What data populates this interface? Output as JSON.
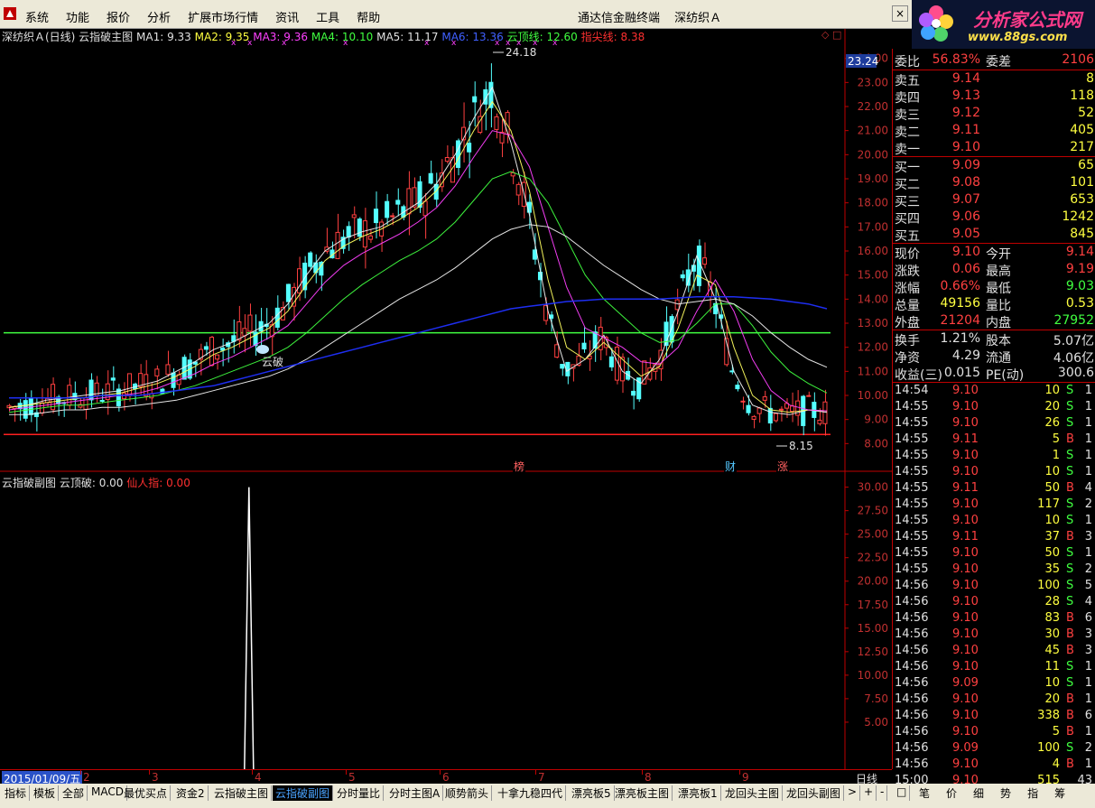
{
  "menubar": {
    "items": [
      "系统",
      "功能",
      "报价",
      "分析",
      "扩展市场行情",
      "资讯",
      "工具",
      "帮助"
    ],
    "center_title": [
      "通达信金融终端",
      "深纺织Ａ"
    ],
    "close": "×"
  },
  "logo": {
    "line1": "分析家公式网",
    "line2": "www.88gs.com"
  },
  "main_chart": {
    "title": "深纺织Ａ(日线) 云指破主图",
    "ma1": "MA1: 9.33",
    "ma2": "MA2: 9.35",
    "ma3": "MA3: 9.36",
    "ma4": "MA4: 10.10",
    "ma5": "MA5: 11.17",
    "ma6": "MA6: 13.36",
    "ydx": "云顶线: 12.60",
    "zjx": "指尖线: 8.38",
    "icons": "◇ □",
    "high_label": "24.18",
    "low_label": "8.15",
    "yun_label": "云破",
    "cur_price": "23.24",
    "markers": [
      "榜",
      "财",
      "涨"
    ]
  },
  "sub_chart": {
    "title": "云指破副图",
    "ydp": "云顶破: 0.00",
    "xrz": "仙人指: 0.00"
  },
  "chart_data": [
    {
      "type": "line",
      "title": "深纺织Ａ(日线) 云指破主图",
      "ylim": [
        7.6,
        24.4
      ],
      "y_ticks": [
        "24.00",
        "23.00",
        "22.00",
        "21.00",
        "20.00",
        "19.00",
        "18.00",
        "17.00",
        "16.00",
        "15.00",
        "14.00",
        "13.00",
        "12.00",
        "11.00",
        "10.00",
        "9.00",
        "8.00"
      ],
      "x_ticks": [
        "2",
        "3",
        "4",
        "5",
        "6",
        "7",
        "8",
        "9"
      ],
      "series": [
        {
          "name": "MA1",
          "values": [
            9.5,
            9.6,
            9.8,
            9.9,
            10.0,
            10.1,
            10.2,
            10.4,
            10.6,
            11.0,
            11.4,
            11.9,
            12.2,
            12.6,
            13.0,
            13.8,
            15.0,
            16.0,
            16.5,
            16.8,
            17.0,
            17.5,
            18.0,
            18.8,
            20.0,
            21.5,
            22.8,
            20.5,
            17.5,
            13.5,
            11.0,
            11.5,
            12.5,
            11.0,
            10.5,
            11.5,
            13.5,
            15.8,
            14.0,
            11.0,
            9.6,
            9.3,
            9.2,
            9.4,
            9.3
          ]
        },
        {
          "name": "MA2",
          "values": [
            9.5,
            9.6,
            9.7,
            9.8,
            9.9,
            10.0,
            10.1,
            10.3,
            10.5,
            10.8,
            11.2,
            11.7,
            12.0,
            12.4,
            12.8,
            13.5,
            14.6,
            15.6,
            16.2,
            16.6,
            16.9,
            17.3,
            17.8,
            18.5,
            19.6,
            21.0,
            22.2,
            21.0,
            18.5,
            14.8,
            12.0,
            11.5,
            12.2,
            11.5,
            10.8,
            11.2,
            12.8,
            15.0,
            14.6,
            12.0,
            10.0,
            9.4,
            9.3,
            9.4,
            9.35
          ]
        },
        {
          "name": "MA3",
          "values": [
            9.4,
            9.5,
            9.6,
            9.7,
            9.8,
            9.9,
            10.0,
            10.1,
            10.3,
            10.6,
            10.9,
            11.3,
            11.6,
            12.0,
            12.4,
            12.9,
            13.8,
            14.7,
            15.4,
            15.9,
            16.3,
            16.7,
            17.2,
            17.8,
            18.7,
            19.9,
            21.0,
            20.8,
            19.5,
            17.0,
            14.5,
            12.8,
            12.4,
            12.0,
            11.4,
            11.3,
            12.0,
            13.5,
            14.8,
            13.5,
            11.5,
            10.2,
            9.6,
            9.4,
            9.36
          ]
        },
        {
          "name": "MA4",
          "values": [
            9.3,
            9.4,
            9.5,
            9.6,
            9.6,
            9.7,
            9.8,
            9.9,
            10.0,
            10.2,
            10.4,
            10.7,
            11.0,
            11.3,
            11.6,
            12.0,
            12.6,
            13.3,
            14.0,
            14.6,
            15.1,
            15.6,
            16.0,
            16.5,
            17.2,
            18.1,
            19.0,
            19.3,
            19.0,
            18.0,
            16.5,
            15.0,
            14.0,
            13.3,
            12.6,
            12.2,
            12.3,
            13.0,
            13.8,
            13.8,
            12.9,
            11.8,
            11.0,
            10.5,
            10.1
          ]
        },
        {
          "name": "MA5",
          "values": [
            9.2,
            9.2,
            9.3,
            9.4,
            9.4,
            9.5,
            9.5,
            9.6,
            9.7,
            9.8,
            10.0,
            10.2,
            10.4,
            10.6,
            10.8,
            11.1,
            11.5,
            12.0,
            12.5,
            13.0,
            13.5,
            14.0,
            14.4,
            14.8,
            15.3,
            15.9,
            16.5,
            16.9,
            17.1,
            17.0,
            16.6,
            16.0,
            15.4,
            14.9,
            14.4,
            14.0,
            13.8,
            13.9,
            14.0,
            13.8,
            13.3,
            12.6,
            12.0,
            11.5,
            11.17
          ]
        },
        {
          "name": "MA6",
          "values": [
            9.9,
            9.9,
            9.9,
            9.9,
            9.9,
            10.0,
            10.0,
            10.0,
            10.1,
            10.2,
            10.3,
            10.4,
            10.6,
            10.8,
            11.0,
            11.2,
            11.4,
            11.6,
            11.8,
            12.0,
            12.2,
            12.4,
            12.6,
            12.8,
            13.0,
            13.2,
            13.4,
            13.6,
            13.7,
            13.8,
            13.9,
            13.95,
            14.0,
            14.0,
            14.0,
            14.0,
            14.05,
            14.1,
            14.1,
            14.1,
            14.05,
            14.0,
            13.9,
            13.8,
            13.6
          ]
        }
      ],
      "hlines": [
        {
          "name": "云顶线",
          "value": 12.6
        },
        {
          "name": "指尖线",
          "value": 8.38
        }
      ]
    },
    {
      "type": "line",
      "title": "云指破副图",
      "ylim": [
        0,
        31.5
      ],
      "y_ticks": [
        "30.00",
        "27.50",
        "25.00",
        "22.50",
        "20.00",
        "17.50",
        "15.00",
        "12.50",
        "10.00",
        "7.50",
        "5.00"
      ],
      "spike": {
        "x_frac": 0.3,
        "value": 30.0
      }
    }
  ],
  "panel": {
    "wb": {
      "label": "委比",
      "value": "56.83%",
      "label2": "委差",
      "value2": "2106"
    },
    "sell": [
      {
        "label": "卖五",
        "price": "9.14",
        "vol": "8"
      },
      {
        "label": "卖四",
        "price": "9.13",
        "vol": "118"
      },
      {
        "label": "卖三",
        "price": "9.12",
        "vol": "52"
      },
      {
        "label": "卖二",
        "price": "9.11",
        "vol": "405"
      },
      {
        "label": "卖一",
        "price": "9.10",
        "vol": "217"
      }
    ],
    "buy": [
      {
        "label": "买一",
        "price": "9.09",
        "vol": "65"
      },
      {
        "label": "买二",
        "price": "9.08",
        "vol": "101"
      },
      {
        "label": "买三",
        "price": "9.07",
        "vol": "653"
      },
      {
        "label": "买四",
        "price": "9.06",
        "vol": "1242"
      },
      {
        "label": "买五",
        "price": "9.05",
        "vol": "845"
      }
    ],
    "quote": [
      {
        "l1": "现价",
        "v1": "9.10",
        "c1": "c-red",
        "l2": "今开",
        "v2": "9.14",
        "c2": "c-red"
      },
      {
        "l1": "涨跌",
        "v1": "0.06",
        "c1": "c-red",
        "l2": "最高",
        "v2": "9.19",
        "c2": "c-red"
      },
      {
        "l1": "涨幅",
        "v1": "0.66%",
        "c1": "c-red",
        "l2": "最低",
        "v2": "9.03",
        "c2": "c-green"
      },
      {
        "l1": "总量",
        "v1": "49156",
        "c1": "c-yellow",
        "l2": "量比",
        "v2": "0.53",
        "c2": "c-yellow"
      },
      {
        "l1": "外盘",
        "v1": "21204",
        "c1": "c-red",
        "l2": "内盘",
        "v2": "27952",
        "c2": "c-green"
      }
    ],
    "fin": [
      {
        "l1": "换手",
        "v1": "1.21%",
        "l2": "股本",
        "v2": "5.07亿"
      },
      {
        "l1": "净资",
        "v1": "4.29",
        "l2": "流通",
        "v2": "4.06亿"
      },
      {
        "l1": "收益(三)",
        "v1": "0.015",
        "l2": "PE(动)",
        "v2": "300.6"
      }
    ],
    "ticks": [
      {
        "t": "14:54",
        "p": "9.10",
        "v": "10",
        "bs": "S",
        "n": "1"
      },
      {
        "t": "14:55",
        "p": "9.10",
        "v": "20",
        "bs": "S",
        "n": "1"
      },
      {
        "t": "14:55",
        "p": "9.10",
        "v": "26",
        "bs": "S",
        "n": "1"
      },
      {
        "t": "14:55",
        "p": "9.11",
        "v": "5",
        "bs": "B",
        "n": "1"
      },
      {
        "t": "14:55",
        "p": "9.10",
        "v": "1",
        "bs": "S",
        "n": "1"
      },
      {
        "t": "14:55",
        "p": "9.10",
        "v": "10",
        "bs": "S",
        "n": "1"
      },
      {
        "t": "14:55",
        "p": "9.11",
        "v": "50",
        "bs": "B",
        "n": "4"
      },
      {
        "t": "14:55",
        "p": "9.10",
        "v": "117",
        "bs": "S",
        "n": "2"
      },
      {
        "t": "14:55",
        "p": "9.10",
        "v": "10",
        "bs": "S",
        "n": "1"
      },
      {
        "t": "14:55",
        "p": "9.11",
        "v": "37",
        "bs": "B",
        "n": "3"
      },
      {
        "t": "14:55",
        "p": "9.10",
        "v": "50",
        "bs": "S",
        "n": "1"
      },
      {
        "t": "14:55",
        "p": "9.10",
        "v": "35",
        "bs": "S",
        "n": "2"
      },
      {
        "t": "14:56",
        "p": "9.10",
        "v": "100",
        "bs": "S",
        "n": "5"
      },
      {
        "t": "14:56",
        "p": "9.10",
        "v": "28",
        "bs": "S",
        "n": "4"
      },
      {
        "t": "14:56",
        "p": "9.10",
        "v": "83",
        "bs": "B",
        "n": "6"
      },
      {
        "t": "14:56",
        "p": "9.10",
        "v": "30",
        "bs": "B",
        "n": "3"
      },
      {
        "t": "14:56",
        "p": "9.10",
        "v": "45",
        "bs": "B",
        "n": "3"
      },
      {
        "t": "14:56",
        "p": "9.10",
        "v": "11",
        "bs": "S",
        "n": "1"
      },
      {
        "t": "14:56",
        "p": "9.09",
        "v": "10",
        "bs": "S",
        "n": "1"
      },
      {
        "t": "14:56",
        "p": "9.10",
        "v": "20",
        "bs": "B",
        "n": "1"
      },
      {
        "t": "14:56",
        "p": "9.10",
        "v": "338",
        "bs": "B",
        "n": "6"
      },
      {
        "t": "14:56",
        "p": "9.10",
        "v": "5",
        "bs": "B",
        "n": "1"
      },
      {
        "t": "14:56",
        "p": "9.09",
        "v": "100",
        "bs": "S",
        "n": "2"
      },
      {
        "t": "14:56",
        "p": "9.10",
        "v": "4",
        "bs": "B",
        "n": "1"
      },
      {
        "t": "15:00",
        "p": "9.10",
        "v": "515",
        "bs": "",
        "n": "43"
      }
    ]
  },
  "datebar": {
    "date": "2015/01/09/五",
    "labels": [
      "2",
      "3",
      "4",
      "5",
      "6",
      "7",
      "8",
      "9"
    ],
    "period": "日线"
  },
  "tabs": [
    "指标",
    "模板",
    "全部",
    "MACD",
    "最优买点",
    "资金2",
    "云指破主图",
    "云指破副图",
    "分时量比",
    "分时主图A",
    "顺势箭头",
    "十拿九稳四代",
    "漂亮板5",
    "漂亮板主图",
    "漂亮板1",
    "龙回头主图",
    "龙回头副图",
    ">",
    "+",
    "-",
    "□"
  ],
  "active_tab": "云指破副图",
  "rtabs": [
    "笔",
    "价",
    "细",
    "势",
    "指",
    "筹"
  ],
  "colors": {
    "up": "#ff4040",
    "down": "#54ffff",
    "axis": "#c00000",
    "bg": "#000000"
  }
}
